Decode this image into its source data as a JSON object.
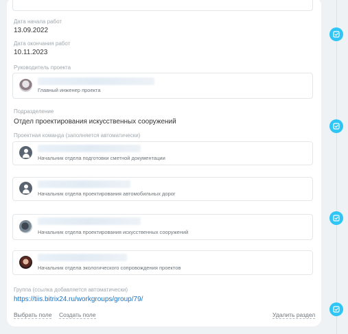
{
  "fields": {
    "start_date": {
      "label": "Дата начала работ",
      "value": "13.09.2022"
    },
    "end_date": {
      "label": "Дата окончания работ",
      "value": "10.11.2023"
    },
    "project_lead": {
      "label": "Руководитель проекта",
      "role": "Главный инженер проекта"
    },
    "department": {
      "label": "Подразделение",
      "value": "Отдел проектирования искусственных сооружений"
    },
    "team": {
      "label": "Проектная команда (заполняется автоматически)",
      "members": [
        {
          "role": "Начальник отдела подготовки сметной документации"
        },
        {
          "role": "Начальник отдела проектирования автомобильных дорог"
        },
        {
          "role": "Начальник отдела проектирования искусственных сооружений"
        },
        {
          "role": "Начальник отдела экологического сопровождения проектов"
        }
      ]
    },
    "group": {
      "label": "Группа (ссылка добавляется автоматически)",
      "url": "https://tiis.bitrix24.ru/workgroups/group/79/"
    }
  },
  "actions": {
    "select_field": "Выбрать поле",
    "create_field": "Создать поле",
    "delete_section": "Удалить раздел"
  },
  "colors": {
    "accent": "#2fc6f6",
    "link": "#1a73c6"
  }
}
